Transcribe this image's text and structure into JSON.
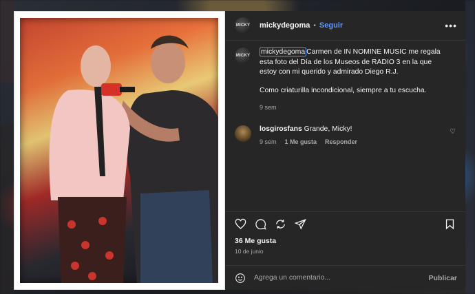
{
  "post": {
    "username": "mickydegoma",
    "avatar_text": "MICKY",
    "follow_label": "Seguir",
    "more_icon": "more-horizontal-icon",
    "caption": {
      "username": "mickydegoma",
      "text": "Carmen de IN NOMINE MUSIC me regala esta foto del Día de los Museos de RADIO 3 en la que estoy con mi querido y admirado Diego R.J.",
      "text2": "Como criaturilla incondicional, siempre a tu escucha.",
      "time": "9 sem"
    },
    "comments": [
      {
        "username": "losgirosfans",
        "text": "Grande, Micky!",
        "time": "9 sem",
        "likes": "1 Me gusta",
        "reply_label": "Responder"
      }
    ],
    "likes": "36 Me gusta",
    "date": "10 de junio",
    "comment_placeholder": "Agrega un comentario...",
    "publish_label": "Publicar"
  },
  "icons": [
    "heart-icon",
    "comment-icon",
    "share-icon",
    "send-icon",
    "bookmark-icon",
    "emoji-icon"
  ]
}
